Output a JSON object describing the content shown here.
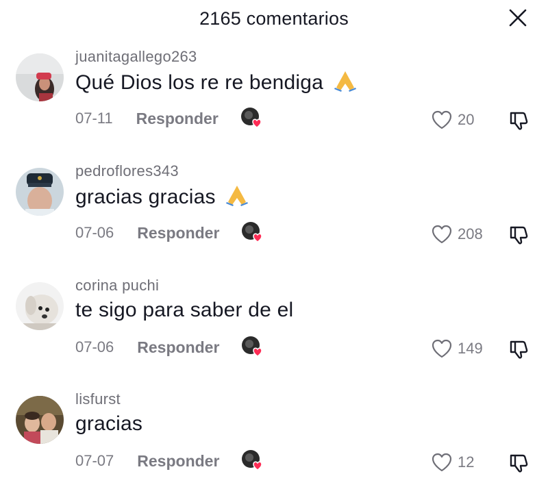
{
  "header": {
    "title": "2165 comentarios"
  },
  "comments": [
    {
      "username": "juanitagallego263",
      "text": "Qué Dios los re re bendiga",
      "date": "07-11",
      "reply_label": "Responder",
      "likes": "20",
      "emoji": "folded-hands"
    },
    {
      "username": "pedroflores343",
      "text": "gracias gracias",
      "date": "07-06",
      "reply_label": "Responder",
      "likes": "208",
      "emoji": "folded-hands"
    },
    {
      "username": "corina puchi",
      "text": "te sigo para saber de el",
      "date": "07-06",
      "reply_label": "Responder",
      "likes": "149",
      "emoji": ""
    },
    {
      "username": "lisfurst",
      "text": "gracias",
      "date": "07-07",
      "reply_label": "Responder",
      "likes": "12",
      "emoji": ""
    }
  ],
  "colors": {
    "text": "#161823",
    "muted": "#7a7a82",
    "heart_badge": "#fe2c55"
  }
}
